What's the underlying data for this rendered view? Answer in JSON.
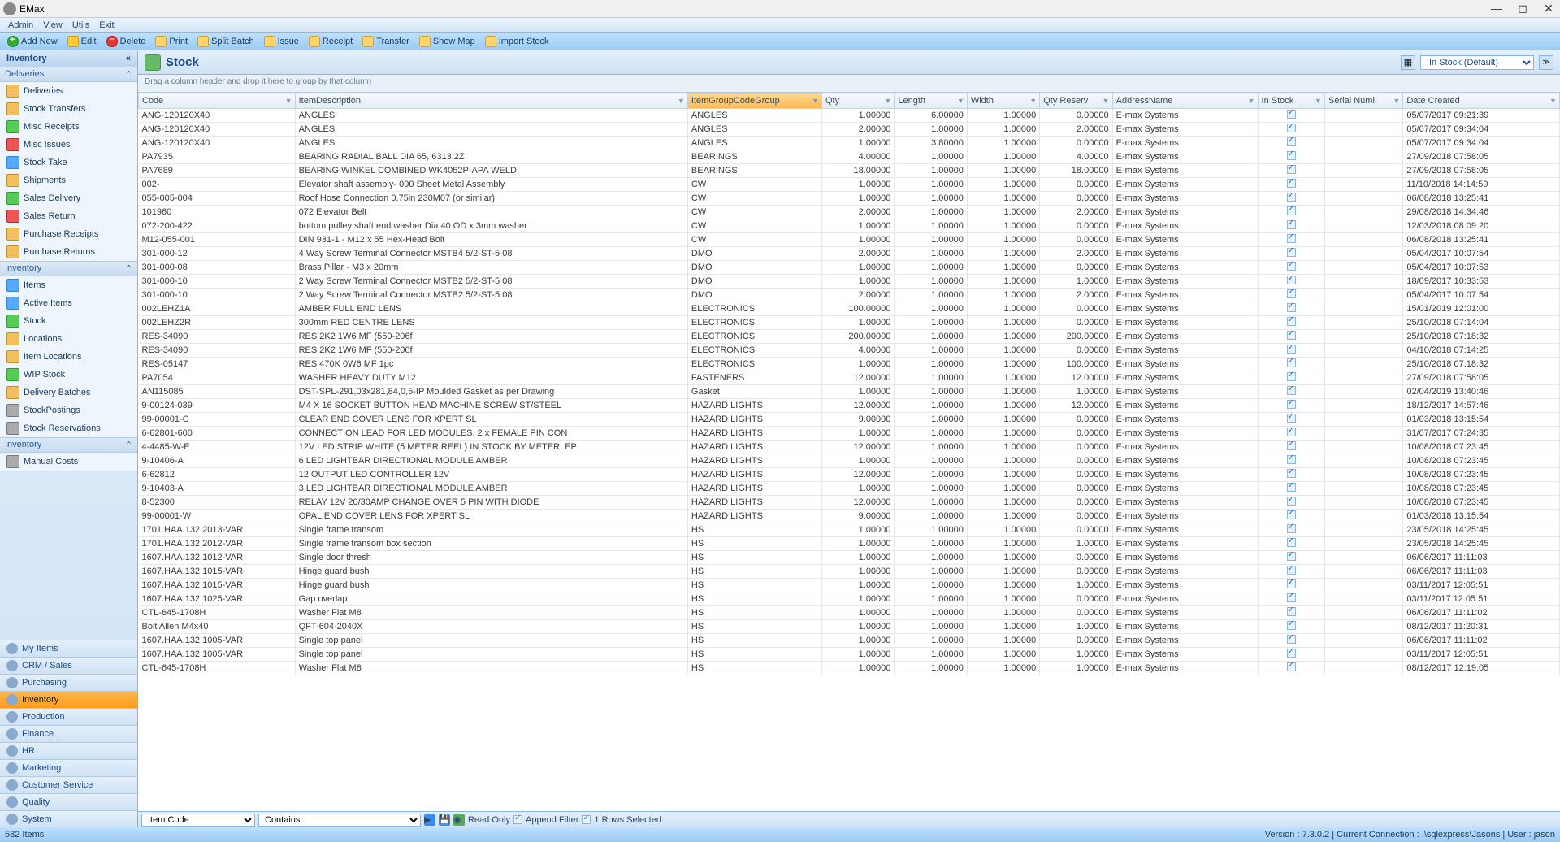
{
  "window": {
    "title": "EMax"
  },
  "menubar": [
    "Admin",
    "View",
    "Utils",
    "Exit"
  ],
  "toolbar": [
    {
      "id": "add",
      "label": "Add New"
    },
    {
      "id": "edit",
      "label": "Edit"
    },
    {
      "id": "delete",
      "label": "Delete"
    },
    {
      "id": "print",
      "label": "Print"
    },
    {
      "id": "splitbatch",
      "label": "Split Batch"
    },
    {
      "id": "issue",
      "label": "Issue"
    },
    {
      "id": "receipt",
      "label": "Receipt"
    },
    {
      "id": "transfer",
      "label": "Transfer"
    },
    {
      "id": "showmap",
      "label": "Show Map"
    },
    {
      "id": "importstock",
      "label": "Import Stock"
    }
  ],
  "sidebar": {
    "title": "Inventory",
    "sections": [
      {
        "title": "Deliveries",
        "items": [
          {
            "icon": "box",
            "label": "Deliveries"
          },
          {
            "icon": "box",
            "label": "Stock Transfers"
          },
          {
            "icon": "green",
            "label": "Misc Receipts"
          },
          {
            "icon": "red",
            "label": "Misc Issues"
          },
          {
            "icon": "blue",
            "label": "Stock Take"
          },
          {
            "icon": "box",
            "label": "Shipments"
          },
          {
            "icon": "green",
            "label": "Sales Delivery"
          },
          {
            "icon": "red",
            "label": "Sales Return"
          },
          {
            "icon": "box",
            "label": "Purchase Receipts"
          },
          {
            "icon": "box",
            "label": "Purchase Returns"
          }
        ]
      },
      {
        "title": "Inventory",
        "items": [
          {
            "icon": "blue",
            "label": "Items"
          },
          {
            "icon": "blue",
            "label": "Active Items"
          },
          {
            "icon": "green",
            "label": "Stock"
          },
          {
            "icon": "box",
            "label": "Locations"
          },
          {
            "icon": "box",
            "label": "Item Locations"
          },
          {
            "icon": "green",
            "label": "WIP Stock"
          },
          {
            "icon": "box",
            "label": "Delivery Batches"
          },
          {
            "icon": "gray",
            "label": "StockPostings"
          },
          {
            "icon": "gray",
            "label": "Stock Reservations"
          }
        ]
      },
      {
        "title": "Inventory",
        "items": [
          {
            "icon": "gray",
            "label": "Manual Costs"
          }
        ]
      }
    ],
    "modules": [
      "My Items",
      "CRM / Sales",
      "Purchasing",
      "Inventory",
      "Production",
      "Finance",
      "HR",
      "Marketing",
      "Customer Service",
      "Quality",
      "System"
    ],
    "activeModule": "Inventory"
  },
  "main": {
    "title": "Stock",
    "viewSelect": "In Stock (Default)",
    "groupbarText": "Drag a column header and drop it here to group by that column"
  },
  "columns": [
    "Code",
    "ItemDescription",
    "ItemGroupCodeGroup",
    "Qty",
    "Length",
    "Width",
    "Qty Reserv",
    "AddressName",
    "In Stock",
    "Serial Numl",
    "Date Created"
  ],
  "sortedCol": "ItemGroupCodeGroup",
  "rows": [
    {
      "code": "ANG-120120X40",
      "desc": "ANGLES",
      "group": "ANGLES",
      "qty": "1.00000",
      "len": "6.00000",
      "wid": "1.00000",
      "res": "0.00000",
      "addr": "E-max Systems",
      "in": true,
      "date": "05/07/2017 09:21:39"
    },
    {
      "code": "ANG-120120X40",
      "desc": "ANGLES",
      "group": "ANGLES",
      "qty": "2.00000",
      "len": "1.00000",
      "wid": "1.00000",
      "res": "2.00000",
      "addr": "E-max Systems",
      "in": true,
      "date": "05/07/2017 09:34:04"
    },
    {
      "code": "ANG-120120X40",
      "desc": "ANGLES",
      "group": "ANGLES",
      "qty": "1.00000",
      "len": "3.80000",
      "wid": "1.00000",
      "res": "0.00000",
      "addr": "E-max Systems",
      "in": true,
      "date": "05/07/2017 09:34:04"
    },
    {
      "code": "PA7935",
      "desc": "BEARING RADIAL BALL DIA 65, 6313.2Z",
      "group": "BEARINGS",
      "qty": "4.00000",
      "len": "1.00000",
      "wid": "1.00000",
      "res": "4.00000",
      "addr": "E-max Systems",
      "in": true,
      "date": "27/09/2018 07:58:05"
    },
    {
      "code": "PA7689",
      "desc": "BEARING WINKEL  COMBINED  WK4052P-APA WELD",
      "group": "BEARINGS",
      "qty": "18.00000",
      "len": "1.00000",
      "wid": "1.00000",
      "res": "18.00000",
      "addr": "E-max Systems",
      "in": true,
      "date": "27/09/2018 07:58:05"
    },
    {
      "code": "002-",
      "desc": "Elevator shaft assembly- 090 Sheet Metal Assembly",
      "group": "CW",
      "qty": "1.00000",
      "len": "1.00000",
      "wid": "1.00000",
      "res": "0.00000",
      "addr": "E-max Systems",
      "in": true,
      "date": "11/10/2018 14:14:59"
    },
    {
      "code": "055-005-004",
      "desc": "Roof Hose Connection 0.75in 230M07 (or similar)",
      "group": "CW",
      "qty": "1.00000",
      "len": "1.00000",
      "wid": "1.00000",
      "res": "0.00000",
      "addr": "E-max Systems",
      "in": true,
      "date": "06/08/2018 13:25:41"
    },
    {
      "code": "101960",
      "desc": "072 Elevator Belt",
      "group": "CW",
      "qty": "2.00000",
      "len": "1.00000",
      "wid": "1.00000",
      "res": "2.00000",
      "addr": "E-max Systems",
      "in": true,
      "date": "29/08/2018 14:34:46"
    },
    {
      "code": "072-200-422",
      "desc": "bottom pulley shaft end washer Dia.40 OD x 3mm washer",
      "group": "CW",
      "qty": "1.00000",
      "len": "1.00000",
      "wid": "1.00000",
      "res": "0.00000",
      "addr": "E-max Systems",
      "in": true,
      "date": "12/03/2018 08:09:20"
    },
    {
      "code": "M12-055-001",
      "desc": "DIN 931-1 - M12 x 55 Hex-Head Bolt",
      "group": "CW",
      "qty": "1.00000",
      "len": "1.00000",
      "wid": "1.00000",
      "res": "0.00000",
      "addr": "E-max Systems",
      "in": true,
      "date": "06/08/2018 13:25:41"
    },
    {
      "code": "301-000-12",
      "desc": "4 Way Screw Terminal Connector MSTB4 5/2-ST-5 08",
      "group": "DMO",
      "qty": "2.00000",
      "len": "1.00000",
      "wid": "1.00000",
      "res": "2.00000",
      "addr": "E-max Systems",
      "in": true,
      "date": "05/04/2017 10:07:54"
    },
    {
      "code": "301-000-08",
      "desc": "Brass Pillar - M3 x 20mm",
      "group": "DMO",
      "qty": "1.00000",
      "len": "1.00000",
      "wid": "1.00000",
      "res": "0.00000",
      "addr": "E-max Systems",
      "in": true,
      "date": "05/04/2017 10:07:53"
    },
    {
      "code": "301-000-10",
      "desc": "2 Way Screw Terminal Connector MSTB2 5/2-ST-5 08",
      "group": "DMO",
      "qty": "1.00000",
      "len": "1.00000",
      "wid": "1.00000",
      "res": "1.00000",
      "addr": "E-max Systems",
      "in": true,
      "date": "18/09/2017 10:33:53"
    },
    {
      "code": "301-000-10",
      "desc": "2 Way Screw Terminal Connector MSTB2 5/2-ST-5 08",
      "group": "DMO",
      "qty": "2.00000",
      "len": "1.00000",
      "wid": "1.00000",
      "res": "2.00000",
      "addr": "E-max Systems",
      "in": true,
      "date": "05/04/2017 10:07:54"
    },
    {
      "code": "002LEHZ1A",
      "desc": "AMBER FULL END LENS",
      "group": "ELECTRONICS",
      "qty": "100.00000",
      "len": "1.00000",
      "wid": "1.00000",
      "res": "0.00000",
      "addr": "E-max Systems",
      "in": true,
      "date": "15/01/2019 12:01:00"
    },
    {
      "code": "002LEHZ2R",
      "desc": "300mm RED CENTRE LENS",
      "group": "ELECTRONICS",
      "qty": "1.00000",
      "len": "1.00000",
      "wid": "1.00000",
      "res": "0.00000",
      "addr": "E-max Systems",
      "in": true,
      "date": "25/10/2018 07:14:04"
    },
    {
      "code": "RES-34090",
      "desc": "RES 2K2 1W6 MF (550-206f",
      "group": "ELECTRONICS",
      "qty": "200.00000",
      "len": "1.00000",
      "wid": "1.00000",
      "res": "200.00000",
      "addr": "E-max Systems",
      "in": true,
      "date": "25/10/2018 07:18:32"
    },
    {
      "code": "RES-34090",
      "desc": "RES 2K2 1W6 MF (550-206f",
      "group": "ELECTRONICS",
      "qty": "4.00000",
      "len": "1.00000",
      "wid": "1.00000",
      "res": "0.00000",
      "addr": "E-max Systems",
      "in": true,
      "date": "04/10/2018 07:14:25"
    },
    {
      "code": "RES-05147",
      "desc": "RES 470K 0W6 MF 1pc",
      "group": "ELECTRONICS",
      "qty": "1.00000",
      "len": "1.00000",
      "wid": "1.00000",
      "res": "100.00000",
      "addr": "E-max Systems",
      "in": true,
      "date": "25/10/2018 07:18:32"
    },
    {
      "code": "PA7054",
      "desc": "WASHER HEAVY DUTY  M12",
      "group": "FASTENERS",
      "qty": "12.00000",
      "len": "1.00000",
      "wid": "1.00000",
      "res": "12.00000",
      "addr": "E-max Systems",
      "in": true,
      "date": "27/09/2018 07:58:05"
    },
    {
      "code": "AN115085",
      "desc": "DST-SPL-291,03x281,84,0,5-IP Moulded Gasket as per Drawing",
      "group": "Gasket",
      "qty": "1.00000",
      "len": "1.00000",
      "wid": "1.00000",
      "res": "1.00000",
      "addr": "E-max Systems",
      "in": true,
      "date": "02/04/2019 13:40:46"
    },
    {
      "code": "9-00124-039",
      "desc": "M4 X 16 SOCKET BUTTON HEAD MACHINE SCREW ST/STEEL",
      "group": "HAZARD LIGHTS",
      "qty": "12.00000",
      "len": "1.00000",
      "wid": "1.00000",
      "res": "12.00000",
      "addr": "E-max Systems",
      "in": true,
      "date": "18/12/2017 14:57:46"
    },
    {
      "code": "99-00001-C",
      "desc": "CLEAR END COVER LENS FOR XPERT SL",
      "group": "HAZARD LIGHTS",
      "qty": "9.00000",
      "len": "1.00000",
      "wid": "1.00000",
      "res": "0.00000",
      "addr": "E-max Systems",
      "in": true,
      "date": "01/03/2018 13:15:54"
    },
    {
      "code": "6-62801-600",
      "desc": "CONNECTION LEAD FOR LED MODULES. 2 x FEMALE PIN CON",
      "group": "HAZARD LIGHTS",
      "qty": "1.00000",
      "len": "1.00000",
      "wid": "1.00000",
      "res": "0.00000",
      "addr": "E-max Systems",
      "in": true,
      "date": "31/07/2017 07:24:35"
    },
    {
      "code": "4-4485-W-E",
      "desc": "12V LED STRIP WHITE (5 METER REEL) IN STOCK BY METER, EP",
      "group": "HAZARD LIGHTS",
      "qty": "12.00000",
      "len": "1.00000",
      "wid": "1.00000",
      "res": "0.00000",
      "addr": "E-max Systems",
      "in": true,
      "date": "10/08/2018 07:23:45"
    },
    {
      "code": "9-10406-A",
      "desc": "6 LED LIGHTBAR DIRECTIONAL MODULE AMBER",
      "group": "HAZARD LIGHTS",
      "qty": "1.00000",
      "len": "1.00000",
      "wid": "1.00000",
      "res": "0.00000",
      "addr": "E-max Systems",
      "in": true,
      "date": "10/08/2018 07:23:45"
    },
    {
      "code": "6-62812",
      "desc": "12 OUTPUT LED CONTROLLER 12V",
      "group": "HAZARD LIGHTS",
      "qty": "12.00000",
      "len": "1.00000",
      "wid": "1.00000",
      "res": "0.00000",
      "addr": "E-max Systems",
      "in": true,
      "date": "10/08/2018 07:23:45"
    },
    {
      "code": "9-10403-A",
      "desc": "3 LED LIGHTBAR DIRECTIONAL MODULE AMBER",
      "group": "HAZARD LIGHTS",
      "qty": "1.00000",
      "len": "1.00000",
      "wid": "1.00000",
      "res": "0.00000",
      "addr": "E-max Systems",
      "in": true,
      "date": "10/08/2018 07:23:45"
    },
    {
      "code": "8-52300",
      "desc": "RELAY 12V 20/30AMP CHANGE OVER 5 PIN WITH DIODE",
      "group": "HAZARD LIGHTS",
      "qty": "12.00000",
      "len": "1.00000",
      "wid": "1.00000",
      "res": "0.00000",
      "addr": "E-max Systems",
      "in": true,
      "date": "10/08/2018 07:23:45"
    },
    {
      "code": "99-00001-W",
      "desc": "OPAL END COVER LENS FOR XPERT SL",
      "group": "HAZARD LIGHTS",
      "qty": "9.00000",
      "len": "1.00000",
      "wid": "1.00000",
      "res": "0.00000",
      "addr": "E-max Systems",
      "in": true,
      "date": "01/03/2018 13:15:54"
    },
    {
      "code": "1701.HAA.132.2013-VAR",
      "desc": "Single frame transom",
      "group": "HS",
      "qty": "1.00000",
      "len": "1.00000",
      "wid": "1.00000",
      "res": "0.00000",
      "addr": "E-max Systems",
      "in": true,
      "date": "23/05/2018 14:25:45"
    },
    {
      "code": "1701.HAA.132.2012-VAR",
      "desc": "Single frame transom box section",
      "group": "HS",
      "qty": "1.00000",
      "len": "1.00000",
      "wid": "1.00000",
      "res": "1.00000",
      "addr": "E-max Systems",
      "in": true,
      "date": "23/05/2018 14:25:45"
    },
    {
      "code": "1607.HAA.132.1012-VAR",
      "desc": "Single door thresh",
      "group": "HS",
      "qty": "1.00000",
      "len": "1.00000",
      "wid": "1.00000",
      "res": "0.00000",
      "addr": "E-max Systems",
      "in": true,
      "date": "06/06/2017 11:11:03"
    },
    {
      "code": "1607.HAA.132.1015-VAR",
      "desc": "Hinge guard bush",
      "group": "HS",
      "qty": "1.00000",
      "len": "1.00000",
      "wid": "1.00000",
      "res": "0.00000",
      "addr": "E-max Systems",
      "in": true,
      "date": "06/06/2017 11:11:03"
    },
    {
      "code": "1607.HAA.132.1015-VAR",
      "desc": "Hinge guard bush",
      "group": "HS",
      "qty": "1.00000",
      "len": "1.00000",
      "wid": "1.00000",
      "res": "1.00000",
      "addr": "E-max Systems",
      "in": true,
      "date": "03/11/2017 12:05:51"
    },
    {
      "code": "1607.HAA.132.1025-VAR",
      "desc": "Gap overlap",
      "group": "HS",
      "qty": "1.00000",
      "len": "1.00000",
      "wid": "1.00000",
      "res": "0.00000",
      "addr": "E-max Systems",
      "in": true,
      "date": "03/11/2017 12:05:51"
    },
    {
      "code": "CTL-645-1708H",
      "desc": "Washer Flat M8",
      "group": "HS",
      "qty": "1.00000",
      "len": "1.00000",
      "wid": "1.00000",
      "res": "0.00000",
      "addr": "E-max Systems",
      "in": true,
      "date": "06/06/2017 11:11:02"
    },
    {
      "code": "Bolt Allen M4x40",
      "desc": "QFT-604-2040X",
      "group": "HS",
      "qty": "1.00000",
      "len": "1.00000",
      "wid": "1.00000",
      "res": "1.00000",
      "addr": "E-max Systems",
      "in": true,
      "date": "08/12/2017 11:20:31"
    },
    {
      "code": "1607.HAA.132.1005-VAR",
      "desc": "Single top panel",
      "group": "HS",
      "qty": "1.00000",
      "len": "1.00000",
      "wid": "1.00000",
      "res": "0.00000",
      "addr": "E-max Systems",
      "in": true,
      "date": "06/06/2017 11:11:02"
    },
    {
      "code": "1607.HAA.132.1005-VAR",
      "desc": "Single top panel",
      "group": "HS",
      "qty": "1.00000",
      "len": "1.00000",
      "wid": "1.00000",
      "res": "1.00000",
      "addr": "E-max Systems",
      "in": true,
      "date": "03/11/2017 12:05:51"
    },
    {
      "code": "CTL-645-1708H",
      "desc": "Washer Flat M8",
      "group": "HS",
      "qty": "1.00000",
      "len": "1.00000",
      "wid": "1.00000",
      "res": "1.00000",
      "addr": "E-max Systems",
      "in": true,
      "date": "08/12/2017 12:19:05"
    }
  ],
  "filterbar": {
    "field": "Item.Code",
    "op": "Contains",
    "readOnly": "Read Only",
    "appendFilter": "Append Filter",
    "rowsSelected": "1 Rows Selected"
  },
  "statusbar": {
    "left": "582 Items",
    "right": "Version : 7.3.0.2 | Current Connection : .\\sqlexpress\\Jasons | User : jason"
  }
}
